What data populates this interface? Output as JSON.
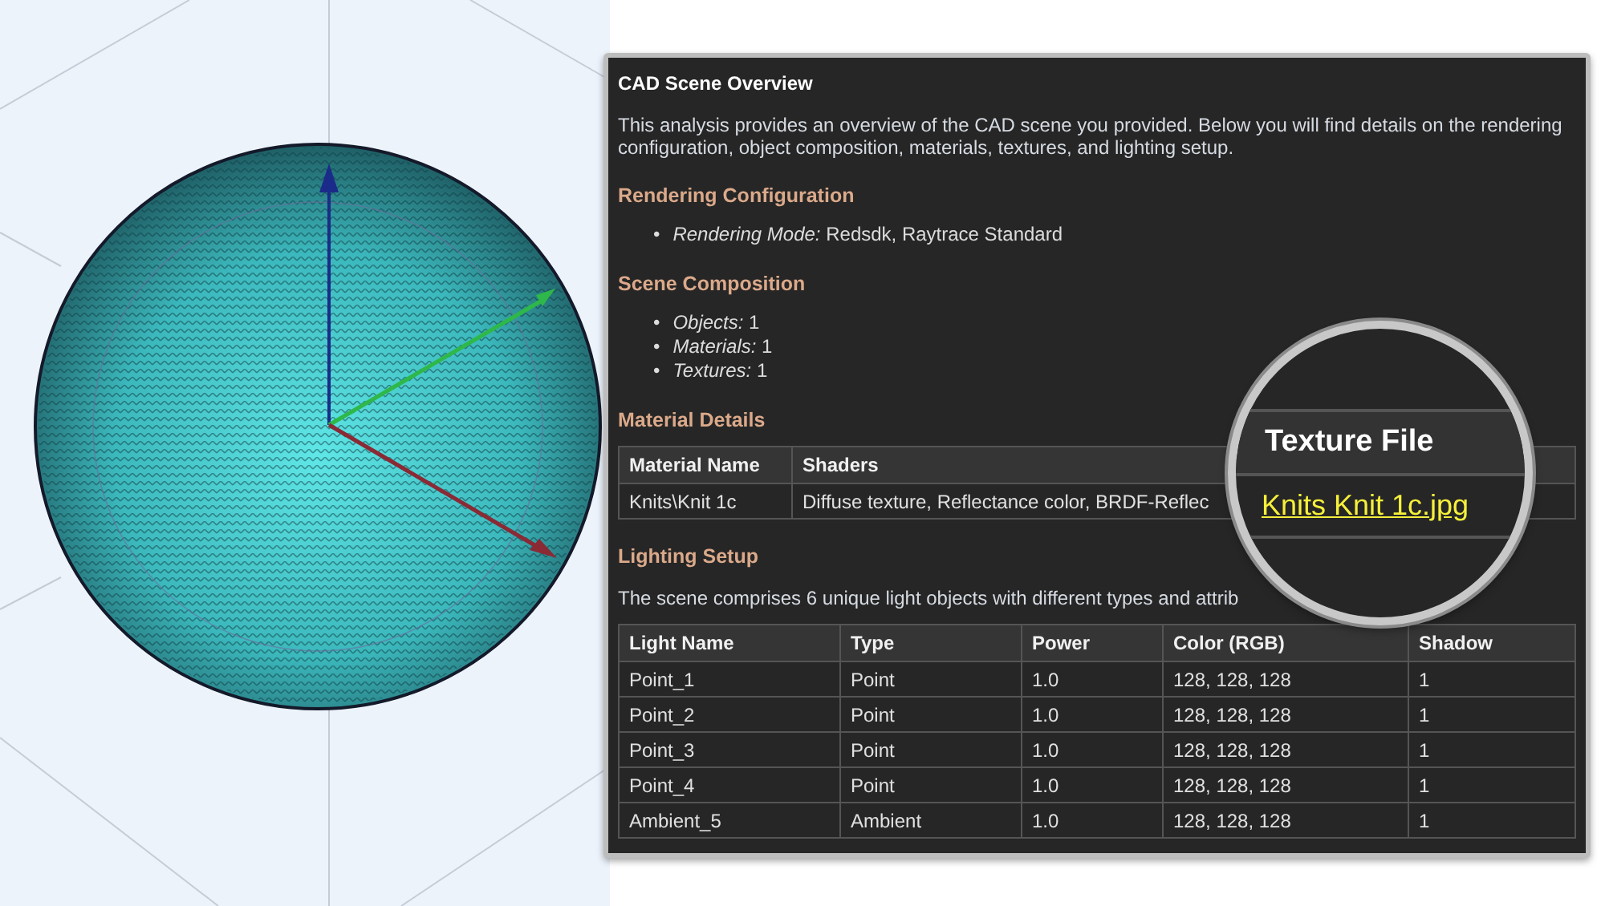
{
  "report": {
    "title": "CAD Scene Overview",
    "intro": "This analysis provides an overview of the CAD scene you provided. Below you will find details on the rendering configuration, object composition, materials, textures, and lighting setup.",
    "sections": [
      {
        "kind": "list",
        "heading": "Rendering Configuration",
        "items": [
          {
            "bullet": "•",
            "label": "Rendering Mode:",
            "value": "Redsdk, Raytrace Standard"
          }
        ]
      },
      {
        "kind": "list",
        "heading": "Scene Composition",
        "items": [
          {
            "bullet": "•",
            "label": "Objects:",
            "value": "1"
          },
          {
            "bullet": "•",
            "label": "Materials:",
            "value": "1"
          },
          {
            "bullet": "•",
            "label": "Textures:",
            "value": "1"
          }
        ]
      },
      {
        "kind": "table",
        "heading": "Material Details",
        "columns": [
          "Material Name",
          "Shaders"
        ],
        "rows": [
          [
            "Knits\\Knit 1c",
            "Diffuse texture, Reflectance color, BRDF-Reflec"
          ]
        ]
      },
      {
        "kind": "table",
        "heading": "Lighting Setup",
        "text": "The scene comprises 6 unique light objects with different types and attrib",
        "columns": [
          "Light Name",
          "Type",
          "Power",
          "Color (RGB)",
          "Shadow"
        ],
        "rows": [
          [
            "Point_1",
            "Point",
            "1.0",
            "128, 128, 128",
            "1"
          ],
          [
            "Point_2",
            "Point",
            "1.0",
            "128, 128, 128",
            "1"
          ],
          [
            "Point_3",
            "Point",
            "1.0",
            "128, 128, 128",
            "1"
          ],
          [
            "Point_4",
            "Point",
            "1.0",
            "128, 128, 128",
            "1"
          ],
          [
            "Ambient_5",
            "Ambient",
            "1.0",
            "128, 128, 128",
            "1"
          ]
        ]
      }
    ]
  },
  "magnifier": {
    "header": "Texture File",
    "link": "Knits Knit 1c.jpg"
  }
}
